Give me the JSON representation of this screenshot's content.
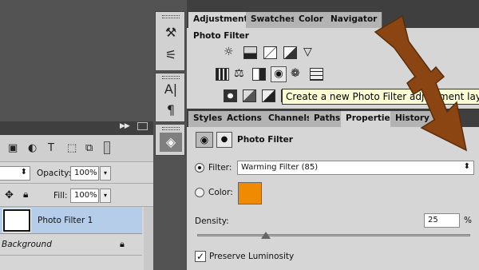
{
  "layers": {
    "opacity_label": "Opacity:",
    "opacity_value": "100%",
    "fill_label": "Fill:",
    "fill_value": "100%",
    "items": [
      {
        "name": "Photo Filter 1"
      },
      {
        "name": "Background"
      }
    ],
    "filter_icons": [
      "image-icon",
      "adjust-icon",
      "type-icon",
      "shape-icon",
      "smart-object-icon",
      "toggle-icon"
    ]
  },
  "adjustments": {
    "tabs": [
      "Adjustments",
      "Swatches",
      "Color",
      "Navigator"
    ],
    "title": "Photo Filter",
    "icons_row1": [
      "brightness-icon",
      "levels-icon",
      "curves-icon",
      "exposure-icon",
      "triangle-icon"
    ],
    "icons_row2": [
      "vibrance-icon",
      "color-balance-icon",
      "bw-icon",
      "photo-filter-icon",
      "channel-mixer-icon",
      "color-lookup-icon"
    ],
    "icons_row3": [
      "invert-icon",
      "posterize-icon",
      "threshold-icon",
      "gradient-map-icon"
    ]
  },
  "tooltip": "Create a new Photo Filter adjustment layer",
  "properties": {
    "tabs": [
      "Styles",
      "Actions",
      "Channels",
      "Paths",
      "Properties",
      "History"
    ],
    "active_tab": "Properties",
    "header": "Photo Filter",
    "filter_label": "Filter:",
    "filter_value": "Warming Filter (85)",
    "color_label": "Color:",
    "color_swatch": "#f08a00",
    "density_label": "Density:",
    "density_value": "25",
    "density_unit": "%",
    "density_level_percent": 25,
    "preserve_label": "Preserve Luminosity",
    "preserve_checked": true
  },
  "toolstrip": {
    "buttons": [
      "brush-presets-icon",
      "tool-presets-icon",
      "character-icon",
      "paragraph-icon",
      "layers-icon"
    ]
  },
  "colors": {
    "arrow": "#8b4513",
    "panel_bg": "#d6d6d6",
    "tabbar_bg": "#3f3f3f",
    "selection": "#b5cde8"
  }
}
